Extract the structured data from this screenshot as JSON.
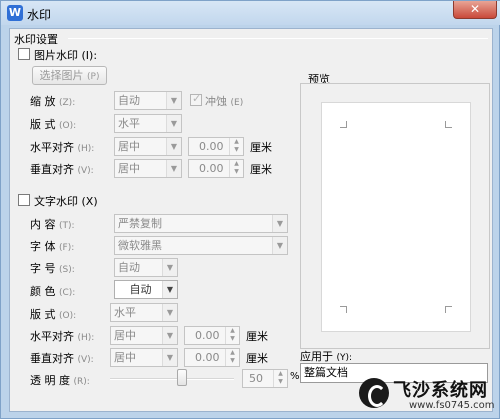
{
  "window": {
    "title": "水印",
    "app_icon_letter": "W",
    "close_glyph": "✕"
  },
  "settings_group": {
    "label": "水印设置"
  },
  "picture": {
    "checkbox_label": "图片水印",
    "checkbox_key": "(I):",
    "select_button": "选择图片",
    "select_key": "(P)",
    "scale_label": "缩   放",
    "scale_key": "(Z):",
    "scale_value": "自动",
    "washout_label": "冲蚀",
    "washout_key": "(E)",
    "layout_label": "版   式",
    "layout_key": "(O):",
    "layout_value": "水平",
    "halign_label": "水平对齐",
    "halign_key": "(H):",
    "halign_value": "居中",
    "halign_offset": "0.00",
    "valign_label": "垂直对齐",
    "valign_key": "(V):",
    "valign_value": "居中",
    "valign_offset": "0.00",
    "unit": "厘米"
  },
  "text": {
    "checkbox_label": "文字水印",
    "checkbox_key": "(X)",
    "content_label": "内   容",
    "content_key": "(T):",
    "content_value": "严禁复制",
    "font_label": "字   体",
    "font_key": "(F):",
    "font_value": "微软雅黑",
    "size_label": "字   号",
    "size_key": "(S):",
    "size_value": "自动",
    "color_label": "颜   色",
    "color_key": "(C):",
    "color_value": "自动",
    "layout_label": "版   式",
    "layout_key": "(O):",
    "layout_value": "水平",
    "halign_label": "水平对齐",
    "halign_key": "(H):",
    "halign_value": "居中",
    "halign_offset": "0.00",
    "valign_label": "垂直对齐",
    "valign_key": "(V):",
    "valign_value": "居中",
    "valign_offset": "0.00",
    "unit": "厘米",
    "opacity_label": "透 明 度",
    "opacity_key": "(R):",
    "opacity_value": "50",
    "opacity_unit": "%",
    "opacity_level": 0.5
  },
  "preview": {
    "label": "预览"
  },
  "apply_to": {
    "label": "应用于",
    "key": "(Y):",
    "value": "整篇文档"
  },
  "watermark_logo": {
    "name": "飞沙系统网",
    "url": "www.fs0745.com"
  },
  "colors": {
    "titlebar": "#c2d7ed",
    "dialog_bg": "#f0f0f0",
    "logo_dark": "#1a1a1a"
  }
}
